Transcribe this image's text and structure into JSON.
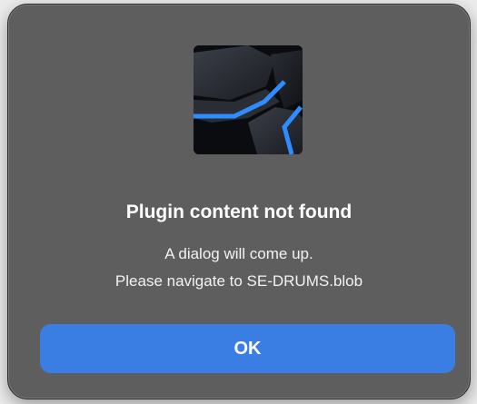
{
  "dialog": {
    "icon": "app-logo-icon",
    "title": "Plugin content not found",
    "message_lines": [
      "A dialog will come up.",
      "Please navigate to SE-DRUMS.blob"
    ],
    "ok_label": "OK"
  },
  "colors": {
    "dialog_background": "#5e5e5e",
    "button_accent": "#3a7ee3",
    "icon_accent": "#2f8cff"
  }
}
